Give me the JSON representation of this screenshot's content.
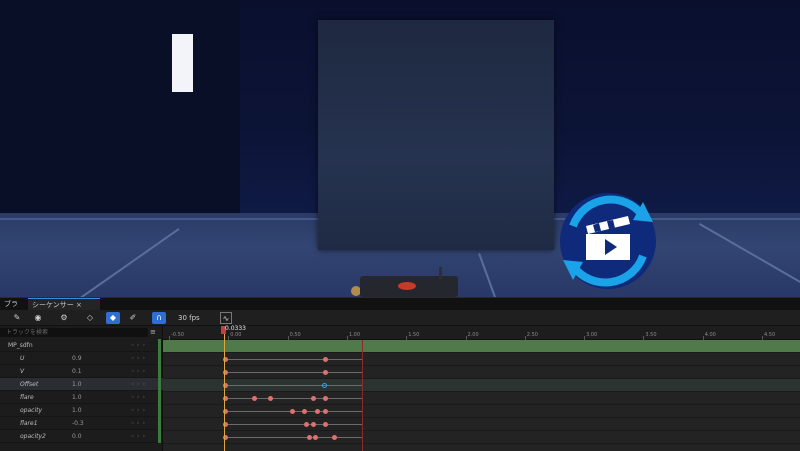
{
  "viewport": {
    "badge_icon": "sequencer-film-clapper-icon"
  },
  "dock": {
    "tabs": [
      {
        "label": "ブラウ..."
      },
      {
        "label": "シーケンサー"
      }
    ],
    "toolbar": {
      "fps_label": "30 fps",
      "icons": [
        "wrench-icon",
        "eye-icon",
        "filter-icon",
        "key-icon",
        "snap-icon",
        "brush-icon",
        "magnet-icon",
        "curve-icon"
      ]
    },
    "search_placeholder": "トラックを検索",
    "tracks": [
      {
        "name": "MP_sdfn",
        "value": "",
        "header": true
      },
      {
        "name": "U",
        "value": "0.9"
      },
      {
        "name": "V",
        "value": "0.1"
      },
      {
        "name": "Offset",
        "value": "1.0",
        "selected": true
      },
      {
        "name": "flare",
        "value": "1.0"
      },
      {
        "name": "opacity",
        "value": "1.0"
      },
      {
        "name": "flare1",
        "value": "-0.3"
      },
      {
        "name": "opacity2",
        "value": "0.0"
      }
    ],
    "timeline": {
      "current_time": "0.0333",
      "ruler_labels": [
        "-0.50",
        "0.00",
        "0.50",
        "1.00",
        "1.50",
        "2.00",
        "2.50",
        "3.00",
        "3.50",
        "4.00",
        "4.50"
      ]
    }
  }
}
